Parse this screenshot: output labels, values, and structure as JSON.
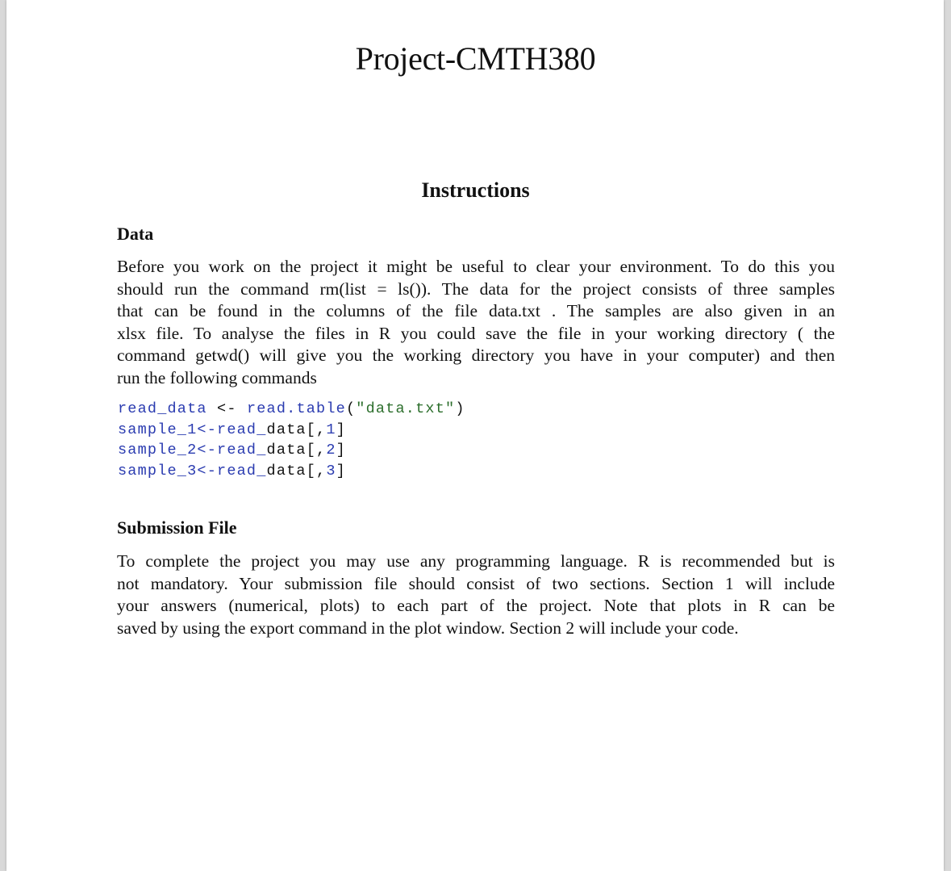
{
  "document": {
    "title": "Project-CMTH380",
    "heading": "Instructions",
    "sections": [
      {
        "heading": "Data",
        "lines": [
          "Before you work on the project it might be useful to clear your environment. To do this you",
          "should run the command rm(list = ls()). The data for the project consists of three samples",
          "that can be found in the columns of the file data.txt .  The samples are also given in an",
          "xlsx file.  To analyse the files in R you could save the file in your working directory ( the",
          "command getwd() will give you the working directory you have in your computer) and then",
          "run the following commands"
        ],
        "code": [
          [
            {
              "t": "read_data",
              "c": "kw"
            },
            {
              "t": " <- ",
              "c": "plain"
            },
            {
              "t": "read.table",
              "c": "kw"
            },
            {
              "t": "(",
              "c": "plain"
            },
            {
              "t": "\"data.txt\"",
              "c": "str"
            },
            {
              "t": ")",
              "c": "plain"
            }
          ],
          [
            {
              "t": "sample_1<-read_",
              "c": "kw"
            },
            {
              "t": "data[,",
              "c": "plain"
            },
            {
              "t": "1",
              "c": "kw"
            },
            {
              "t": "]",
              "c": "plain"
            }
          ],
          [
            {
              "t": "sample_2<-read_",
              "c": "kw"
            },
            {
              "t": "data[,",
              "c": "plain"
            },
            {
              "t": "2",
              "c": "kw"
            },
            {
              "t": "]",
              "c": "plain"
            }
          ],
          [
            {
              "t": "sample_3<-read_",
              "c": "kw"
            },
            {
              "t": "data[,",
              "c": "plain"
            },
            {
              "t": "3",
              "c": "kw"
            },
            {
              "t": "]",
              "c": "plain"
            }
          ]
        ]
      },
      {
        "heading": "Submission File",
        "lines": [
          "To complete the project you may use any programming language.  R is recommended but is",
          "not mandatory.  Your submission file should consist of two sections.  Section 1 will include",
          "your answers (numerical, plots) to each part of the project.  Note that plots in R can be",
          "saved by using the export command in the plot window.  Section 2 will include your code."
        ]
      }
    ],
    "colors": {
      "code_keyword": "#2a3bb0",
      "code_string": "#2b6e2b",
      "text": "#111111",
      "page_background": "#ffffff",
      "viewer_background": "#d9d9d9"
    }
  }
}
